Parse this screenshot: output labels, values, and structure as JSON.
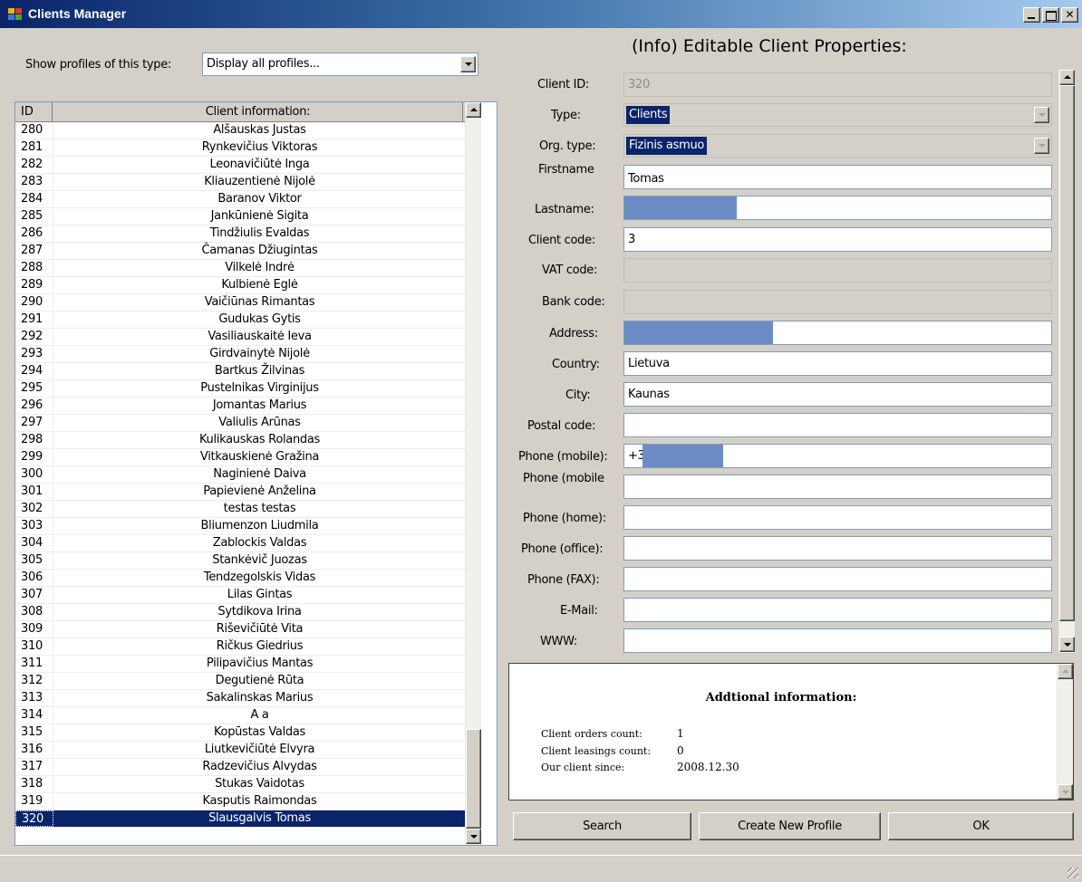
{
  "window": {
    "title": "Clients Manager"
  },
  "filter": {
    "label": "Show profiles of this type:",
    "value": "Display all profiles..."
  },
  "list": {
    "columns": [
      "ID",
      "Client information:"
    ],
    "rows": [
      [
        "280",
        "Alšauskas Justas"
      ],
      [
        "281",
        "Rynkevičius Viktoras"
      ],
      [
        "282",
        "Leonavičiūtė Inga"
      ],
      [
        "283",
        "Kliauzentienė Nijolė"
      ],
      [
        "284",
        "Baranov Viktor"
      ],
      [
        "285",
        "Jankūnienė Sigita"
      ],
      [
        "286",
        "Tindžiulis Evaldas"
      ],
      [
        "287",
        "Čamanas Džiugintas"
      ],
      [
        "288",
        "Vilkelė  Indrė"
      ],
      [
        "289",
        "Kulbienė Eglė"
      ],
      [
        "290",
        "Vaičiūnas Rimantas"
      ],
      [
        "291",
        "Gudukas Gytis"
      ],
      [
        "292",
        "Vasiliauskaitė Ieva"
      ],
      [
        "293",
        "Girdvainytė Nijolė"
      ],
      [
        "294",
        "Bartkus Žilvinas"
      ],
      [
        "295",
        "Pustelnikas Virginijus"
      ],
      [
        "296",
        "Jomantas Marius"
      ],
      [
        "297",
        "Valiulis Arūnas"
      ],
      [
        "298",
        "Kulikauskas Rolandas"
      ],
      [
        "299",
        "Vitkauskienė Gražina"
      ],
      [
        "300",
        "Naginienė Daiva"
      ],
      [
        "301",
        "Papievienė Anželina"
      ],
      [
        "302",
        "testas testas"
      ],
      [
        "303",
        "Bliumenzon Liudmila"
      ],
      [
        "304",
        "Zablockis Valdas"
      ],
      [
        "305",
        "Stankėvič Juozas"
      ],
      [
        "306",
        "Tendzegolskis Vidas"
      ],
      [
        "307",
        "Lilas Gintas"
      ],
      [
        "308",
        "Sytdikova Irina"
      ],
      [
        "309",
        "Riševičiūtė Vita"
      ],
      [
        "310",
        "Ričkus Giedrius"
      ],
      [
        "311",
        "Pilipavičius Mantas"
      ],
      [
        "312",
        "Degutienė Rūta"
      ],
      [
        "313",
        "Sakalinskas Marius"
      ],
      [
        "314",
        "A a"
      ],
      [
        "315",
        "Kopūstas Valdas"
      ],
      [
        "316",
        "Liutkevičiūtė Elvyra"
      ],
      [
        "317",
        "Radzevičius Alvydas"
      ],
      [
        "318",
        "Stukas Vaidotas"
      ],
      [
        "319",
        "Kasputis Raimondas"
      ],
      [
        "320",
        "Slausgalvis Tomas"
      ]
    ],
    "selected_id": "320"
  },
  "properties": {
    "heading": "(Info) Editable Client Properties:",
    "client_id": {
      "label": "Client ID:",
      "value": "320"
    },
    "type": {
      "label": "Type:",
      "value": "Clients"
    },
    "org_type": {
      "label": "Org. type:",
      "value": "Fizinis asmuo"
    },
    "firstname": {
      "label": "Firstname",
      "value": "Tomas"
    },
    "lastname": {
      "label": "Lastname:",
      "value": ""
    },
    "client_code": {
      "label": "Client code:",
      "value": "3"
    },
    "vat_code": {
      "label": "VAT code:",
      "value": ""
    },
    "bank_code": {
      "label": "Bank code:",
      "value": ""
    },
    "address": {
      "label": "Address:",
      "value": ""
    },
    "country": {
      "label": "Country:",
      "value": "Lietuva"
    },
    "city": {
      "label": "City:",
      "value": "Kaunas"
    },
    "postal_code": {
      "label": "Postal code:",
      "value": ""
    },
    "phone_mobile": {
      "label": "Phone (mobile):",
      "value": "+3"
    },
    "phone_mobile2": {
      "label": "Phone (mobile",
      "value": ""
    },
    "phone_home": {
      "label": "Phone (home):",
      "value": ""
    },
    "phone_office": {
      "label": "Phone (office):",
      "value": ""
    },
    "phone_fax": {
      "label": "Phone (FAX):",
      "value": ""
    },
    "email": {
      "label": "E-Mail:",
      "value": ""
    },
    "www": {
      "label": "WWW:",
      "value": ""
    }
  },
  "additional": {
    "title": "Addtional information:",
    "orders_label": "Client orders count:",
    "orders_value": "1",
    "leasings_label": "Client leasings count:",
    "leasings_value": "0",
    "since_label": "Our client since:",
    "since_value": "2008.12.30"
  },
  "buttons": {
    "search": "Search",
    "create": "Create New Profile",
    "ok": "OK"
  },
  "colors": {
    "selection": "#0a246a",
    "redaction": "#6c8cc5",
    "titlebar_start": "#0a246a",
    "titlebar_end": "#a6caf0"
  }
}
